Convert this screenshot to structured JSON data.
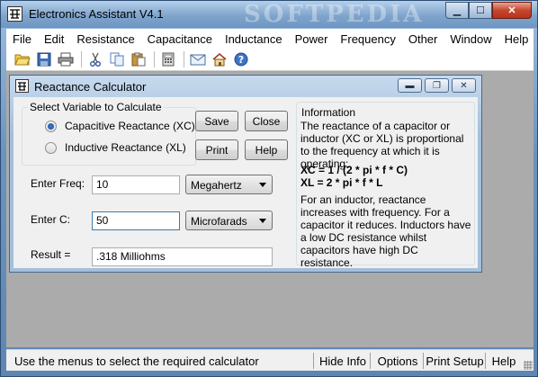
{
  "window": {
    "title": "Electronics Assistant V4.1",
    "watermark": "SOFTPEDIA",
    "minimize_label": "▁",
    "maximize_label": "☐",
    "close_label": "✕"
  },
  "menu": [
    "File",
    "Edit",
    "Resistance",
    "Capacitance",
    "Inductance",
    "Power",
    "Frequency",
    "Other",
    "Window",
    "Help"
  ],
  "toolbar": {
    "icons": [
      "open-folder-icon",
      "save-icon",
      "print-icon",
      "cut-icon",
      "copy-icon",
      "paste-icon",
      "calculator-icon",
      "mail-icon",
      "home-icon",
      "help-icon"
    ]
  },
  "calculator": {
    "title": "Reactance Calculator",
    "minimize_label": "▬",
    "restore_label": "❐",
    "close_label": "✕",
    "group_label": "Select Variable to Calculate",
    "options": [
      {
        "label": "Capacitive Reactance (XC)",
        "checked": true
      },
      {
        "label": "Inductive Reactance (XL)",
        "checked": false
      }
    ],
    "buttons": {
      "save": "Save",
      "close": "Close",
      "print": "Print",
      "help": "Help"
    },
    "freq_label": "Enter Freq:",
    "freq_value": "10",
    "freq_unit": "Megahertz",
    "c_label": "Enter C:",
    "c_value": "50",
    "c_unit": "Microfarads",
    "result_label": "Result =",
    "result_value": ".318 Milliohms"
  },
  "info": {
    "heading": "Information",
    "para1": "The reactance of a capacitor or inductor (XC or XL) is proportional to the frequency at which it is operating:",
    "formula_xc": "XC = 1 / (2 * pi * f * C)",
    "formula_xl": "XL = 2 * pi * f * L",
    "para2": "For an inductor, reactance increases with frequency. For a capacitor it reduces. Inductors have a low DC resistance whilst capacitors have high DC resistance."
  },
  "statusbar": {
    "message": "Use the menus to select the required calculator",
    "hide_info": "Hide Info",
    "options": "Options",
    "print_setup": "Print Setup",
    "help": "Help"
  },
  "colors": {
    "titlebar": "#7fa4cc",
    "client_bg": "#ababab",
    "dialog_bg": "#f0f0f0",
    "close_red": "#c4472e"
  }
}
